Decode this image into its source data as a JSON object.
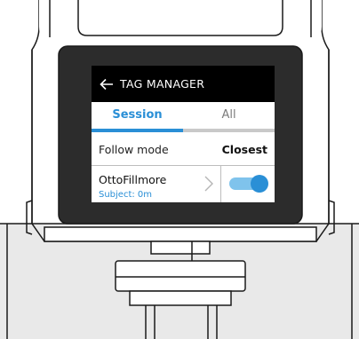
{
  "header": {
    "title": "TAG MANAGER",
    "back_icon": "arrow-left-icon"
  },
  "tabs": [
    {
      "label": "Session",
      "active": true
    },
    {
      "label": "All",
      "active": false
    }
  ],
  "follow_mode": {
    "label": "Follow mode",
    "value": "Closest"
  },
  "tag_row": {
    "name": "OttoFillmore",
    "subtitle": "Subject: 0m",
    "chevron_icon": "chevron-right-icon",
    "toggle_on": true
  },
  "colors": {
    "accent": "#2a8fd6",
    "accent_light": "#7fc3ec",
    "titlebar": "#000000",
    "bezel": "#2c2c2c",
    "housing": "#ececec"
  }
}
